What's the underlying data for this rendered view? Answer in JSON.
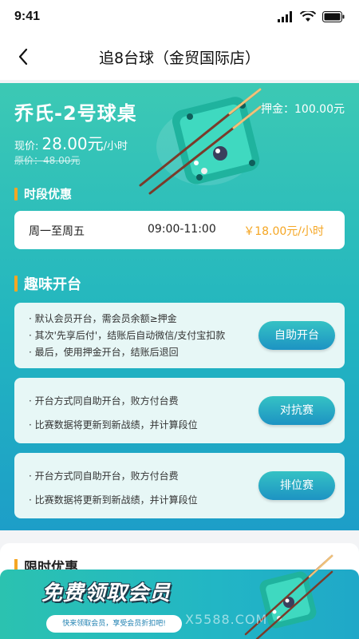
{
  "status_bar": {
    "time": "9:41"
  },
  "nav": {
    "title": "追8台球（金贸国际店）"
  },
  "table": {
    "name": "乔氏-2号球桌",
    "deposit": "押金：100.00元",
    "price_label": "现价:",
    "price_value": "28.00元",
    "price_unit": "/小时",
    "old_price": "原价：48.00元"
  },
  "period_section": {
    "title": "时段优惠",
    "days": "周一至周五",
    "hours": "09:00-11:00",
    "price": "￥18.00元/小时"
  },
  "fun_section": {
    "title": "趣味开台",
    "cards": [
      {
        "lines": [
          "· 默认会员开台，需会员余额≥押金",
          "· 其次'先享后付'，结账后自动微信/支付宝扣款",
          "· 最后，使用押金开台，结账后退回"
        ],
        "button": "自助开台"
      },
      {
        "lines": [
          "· 开台方式同自助开台，败方付台费",
          "· 比赛数据将更新到新战绩，并计算段位"
        ],
        "button": "对抗赛"
      },
      {
        "lines": [
          "· 开台方式同自助开台，败方付台费",
          "· 比赛数据将更新到新战绩，并计算段位"
        ],
        "button": "排位赛"
      }
    ]
  },
  "limited_section": {
    "title": "限时优惠"
  },
  "banner": {
    "title": "免费领取会员",
    "subtitle": "快来领取会员，享受会员折扣吧!",
    "watermark": "X5588.COM"
  },
  "colors": {
    "accent": "#f5a623",
    "teal": "#2bbfb5",
    "button": "#1d93c3"
  }
}
